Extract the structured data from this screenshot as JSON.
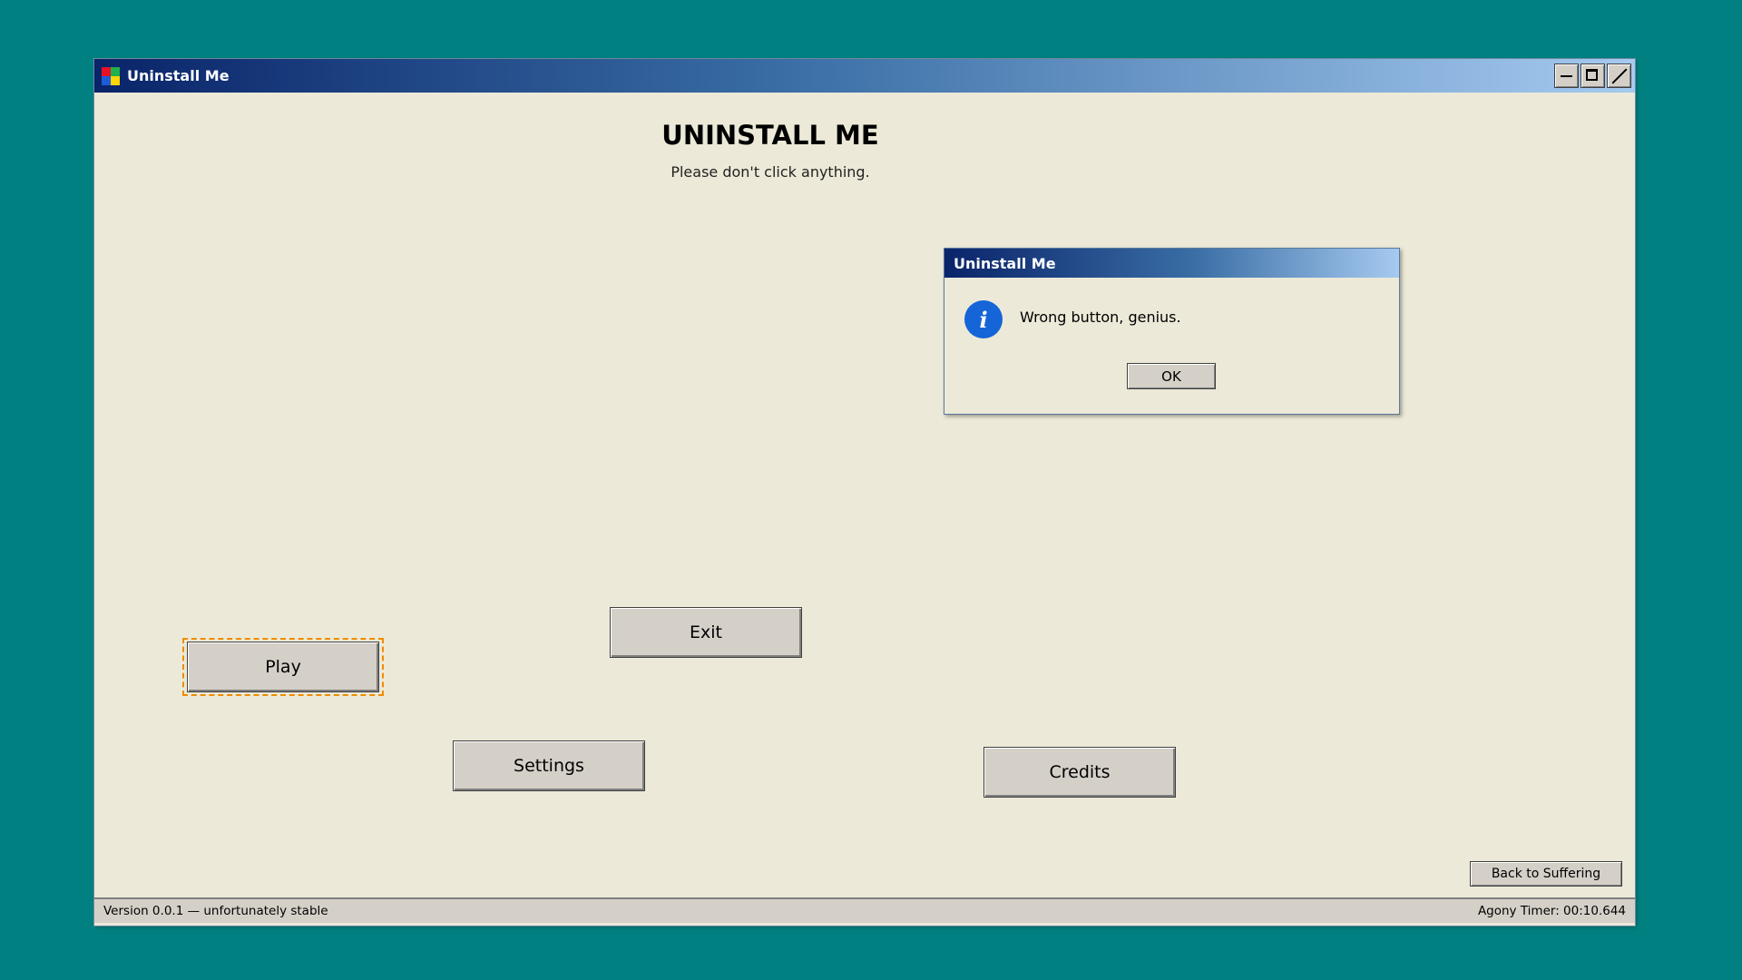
{
  "window": {
    "title": "Uninstall Me",
    "icon": "windows-logo-icon",
    "controls": [
      "minimize-icon",
      "maximize-icon",
      "close-icon"
    ]
  },
  "main": {
    "heading": "UNINSTALL ME",
    "subtitle": "Please don't click anything."
  },
  "buttons": {
    "play": "Play",
    "exit": "Exit",
    "settings": "Settings",
    "credits": "Credits",
    "back": "Back to Suffering"
  },
  "dialog": {
    "title": "Uninstall Me",
    "icon": "info-icon",
    "icon_glyph": "i",
    "message": "Wrong button, genius.",
    "ok_label": "OK"
  },
  "statusbar": {
    "version": "Version 0.0.1 — unfortunately stable",
    "timer": "Agony Timer: 00:10.644"
  },
  "colors": {
    "desktop": "#008080",
    "window_bg": "#ece9d8",
    "focus_ring": "#f08c00",
    "info_icon": "#1565d8"
  }
}
